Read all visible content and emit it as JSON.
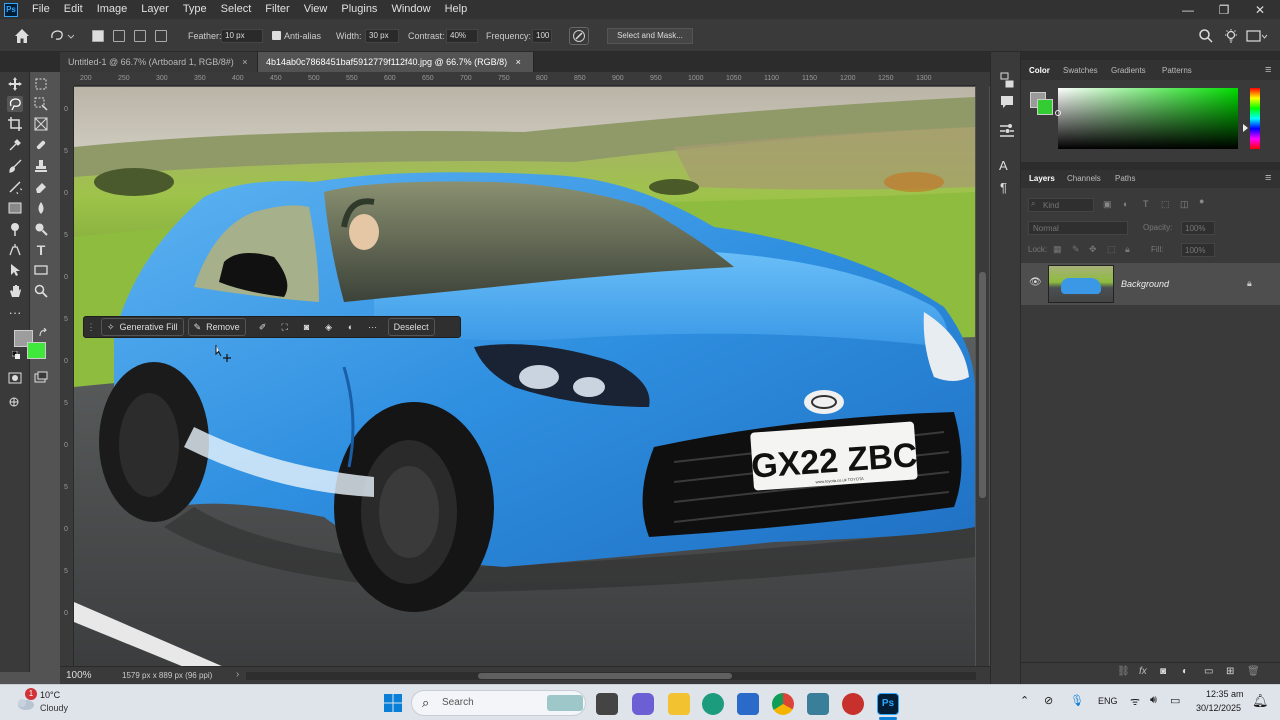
{
  "app": {
    "logo": "Ps"
  },
  "menu": [
    "File",
    "Edit",
    "Image",
    "Layer",
    "Type",
    "Select",
    "Filter",
    "View",
    "Plugins",
    "Window",
    "Help"
  ],
  "window_controls": {
    "minimize": "—",
    "maximize": "❐",
    "close": "✕"
  },
  "options": {
    "feather_label": "Feather:",
    "feather_value": "10 px",
    "antialias_label": "Anti-alias",
    "width_label": "Width:",
    "width_value": "30 px",
    "contrast_label": "Contrast:",
    "contrast_value": "40%",
    "frequency_label": "Frequency:",
    "frequency_value": "100",
    "select_mask_label": "Select and Mask..."
  },
  "tabs": [
    {
      "label": "Untitled-1 @ 66.7% (Artboard 1, RGB/8#)",
      "close": "×"
    },
    {
      "label": "4b14ab0c7868451baf5912779f112f40.jpg @ 66.7% (RGB/8)",
      "close": "×"
    }
  ],
  "ruler": {
    "h": [
      "200",
      "250",
      "300",
      "350",
      "400",
      "450",
      "500",
      "550",
      "600",
      "650",
      "700",
      "750",
      "800",
      "850",
      "900",
      "950",
      "1000",
      "1050",
      "1100",
      "1150",
      "1200",
      "1250",
      "1300"
    ],
    "v": [
      "0",
      "5",
      "0",
      "5",
      "0",
      "5",
      "0",
      "5",
      "0",
      "5",
      "0",
      "5",
      "0"
    ]
  },
  "context_bar": {
    "generative_fill": "Generative Fill",
    "remove": "Remove",
    "more": "···",
    "deselect": "Deselect"
  },
  "photo": {
    "plate": "GX22 ZBC",
    "plate_small": "www.toyota.co.uk   TOYOTA"
  },
  "status": {
    "zoom": "100%",
    "doc_info": "1579 px x 889 px (96 ppi)",
    "arrow": "›"
  },
  "color_panel": {
    "tabs": [
      "Color",
      "Swatches",
      "Gradients",
      "Patterns"
    ],
    "active": "Color",
    "fg": "#9a9a9a",
    "bg": "#33cc33",
    "spectrum_hue": "#00dd00"
  },
  "layers_panel": {
    "tabs": [
      "Layers",
      "Channels",
      "Paths"
    ],
    "active": "Layers",
    "kind_placeholder": "Kind",
    "blend_mode": "Normal",
    "opacity_label": "Opacity:",
    "opacity_value": "100%",
    "lock_label": "Lock:",
    "fill_label": "Fill:",
    "fill_value": "100%",
    "layers": [
      {
        "name": "Background",
        "locked": true,
        "visible": true
      }
    ]
  },
  "toolbar_colors": {
    "fg": "#9d9d9d",
    "bg": "#3fe83a"
  },
  "taskbar": {
    "weather_temp": "10°C",
    "weather_desc": "Cloudy",
    "weather_badge": "1",
    "search_placeholder": "Search",
    "lang": "ENG",
    "time": "12:35 am",
    "date": "30/12/2025"
  }
}
